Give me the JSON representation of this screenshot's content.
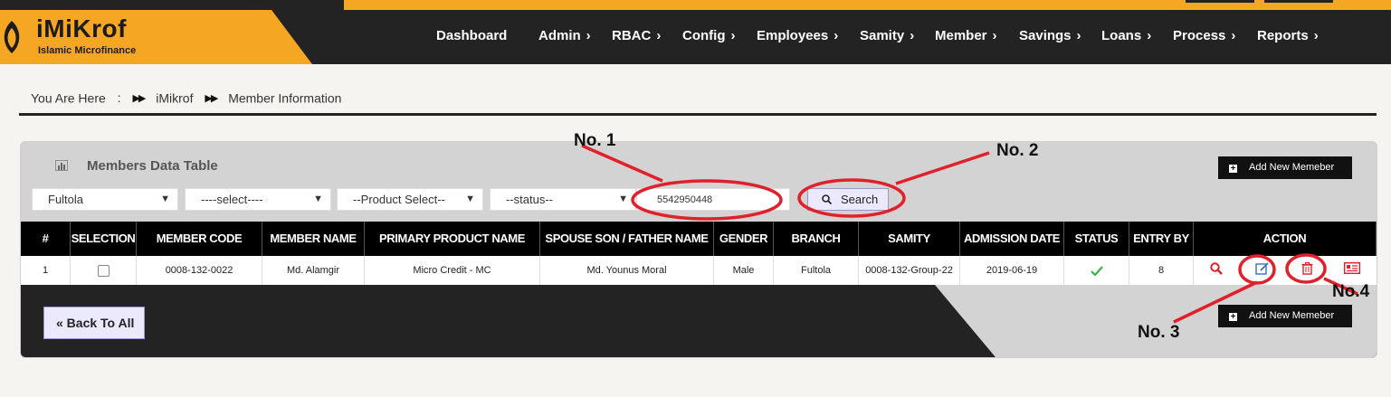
{
  "app": {
    "name": "iMiKrof",
    "subtitle": "Islamic Microfinance"
  },
  "nav": {
    "items": [
      {
        "label": "Dashboard",
        "chevron": false
      },
      {
        "label": "Admin",
        "chevron": true
      },
      {
        "label": "RBAC",
        "chevron": true
      },
      {
        "label": "Config",
        "chevron": true
      },
      {
        "label": "Employees",
        "chevron": true
      },
      {
        "label": "Samity",
        "chevron": true
      },
      {
        "label": "Member",
        "chevron": true
      },
      {
        "label": "Savings",
        "chevron": true
      },
      {
        "label": "Loans",
        "chevron": true
      },
      {
        "label": "Process",
        "chevron": true
      },
      {
        "label": "Reports",
        "chevron": true
      }
    ],
    "chevron_glyph": "›"
  },
  "breadcrumb": {
    "prefix": "You Are Here",
    "colon": ":",
    "sep_glyph": "▶▶",
    "items": [
      "iMikrof",
      "Member Information"
    ]
  },
  "panel": {
    "title": "Members Data Table",
    "title_icon": "bar-chart-icon",
    "add_button_label": "Add New Memeber",
    "filters": {
      "branch": "Fultola",
      "select": "----select----",
      "product": "--Product Select--",
      "status": "--status--",
      "search_value": "5542950448"
    },
    "search_button_label": "Search",
    "back_button_label": "« Back To All"
  },
  "table": {
    "headers": [
      "#",
      "SELECTION",
      "MEMBER CODE",
      "MEMBER NAME",
      "PRIMARY PRODUCT NAME",
      "SPOUSE SON / FATHER NAME",
      "GENDER",
      "BRANCH",
      "SAMITY",
      "ADMISSION DATE",
      "STATUS",
      "ENTRY BY",
      "ACTION"
    ],
    "rows": [
      {
        "index": "1",
        "selected": false,
        "member_code": "0008-132-0022",
        "member_name": "Md. Alamgir",
        "primary_product": "Micro Credit - MC",
        "guardian": "Md. Younus Moral",
        "gender": "Male",
        "branch": "Fultola",
        "samity": "0008-132-Group-22",
        "admission_date": "2019-06-19",
        "status": "active",
        "entry_by": "8",
        "actions": [
          "view-icon",
          "edit-icon",
          "delete-icon",
          "id-card-icon"
        ]
      }
    ]
  },
  "annotations": {
    "labels": [
      "No. 1",
      "No. 2",
      "No. 3",
      "No.4"
    ],
    "color": "#e0202a"
  },
  "colors": {
    "brand_orange": "#f5a623",
    "header_dark": "#232323",
    "panel_gray": "#d4d3d3",
    "action_red": "#e0202a",
    "action_blue": "#3a6fb5",
    "status_green": "#3bb34a"
  }
}
